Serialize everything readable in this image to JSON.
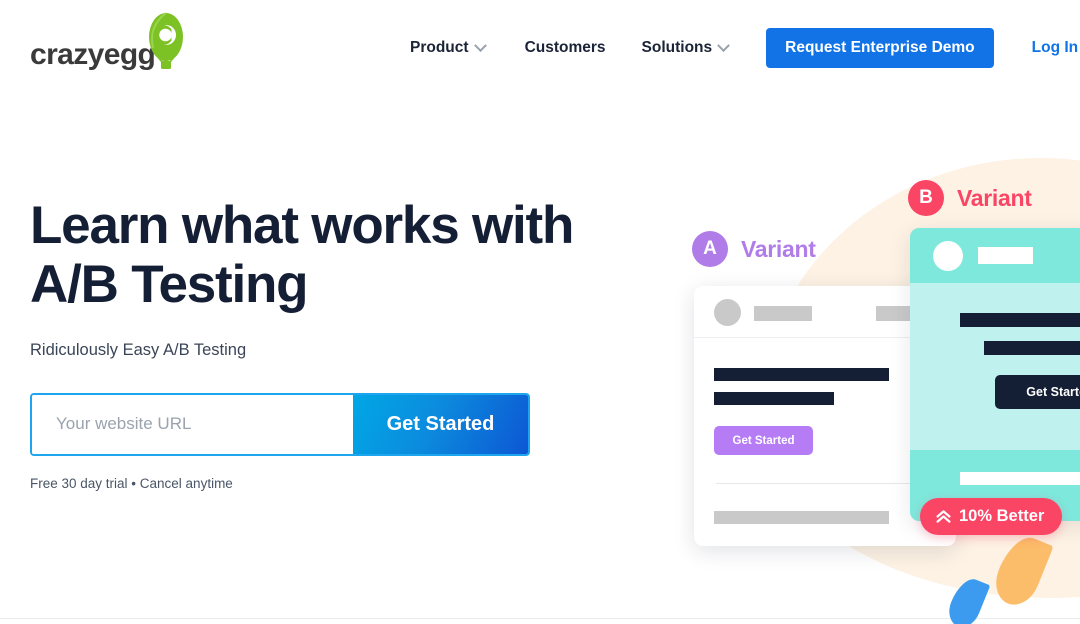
{
  "brand": {
    "logo_text": "crazyegg",
    "logo_tm": "™",
    "logo_icon": "hot-air-balloon-icon",
    "green": "#7DC225"
  },
  "nav": {
    "items": [
      {
        "label": "Product",
        "has_chevron": true
      },
      {
        "label": "Customers",
        "has_chevron": false
      },
      {
        "label": "Solutions",
        "has_chevron": true
      }
    ],
    "demo_button": "Request Enterprise Demo",
    "login_link": "Log In",
    "accent_blue": "#1273E6"
  },
  "hero": {
    "headline_line1": "Learn what works with",
    "headline_line2": "A/B Testing",
    "subheadline": "Ridiculously Easy A/B Testing",
    "form": {
      "input_value": "",
      "input_placeholder": "Your website URL",
      "submit_label": "Get Started"
    },
    "fineprint": "Free 30 day trial • Cancel anytime"
  },
  "illustration": {
    "variant_a": {
      "badge_letter": "A",
      "label": "Variant",
      "color": "#B07CE8",
      "button_label": "Get Started",
      "button_color": "#B57CF5"
    },
    "variant_b": {
      "badge_letter": "B",
      "label": "Variant",
      "color": "#FA4565",
      "button_label": "Get Started",
      "button_color": "#141F35",
      "header_color": "#7EE8DC",
      "body_color": "#BFF2EE"
    },
    "better_badge": {
      "icon": "double-chevron-up-icon",
      "label": "10% Better",
      "color": "#FA4565"
    },
    "blob_color": "#FDF2E4"
  }
}
